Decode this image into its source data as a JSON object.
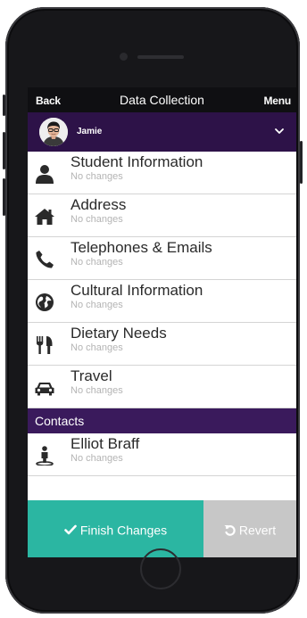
{
  "nav": {
    "back": "Back",
    "title": "Data Collection",
    "menu": "Menu"
  },
  "user": {
    "name": "Jamie"
  },
  "menu": {
    "items": [
      {
        "title": "Student Information",
        "status": "No changes",
        "icon": "user-icon"
      },
      {
        "title": "Address",
        "status": "No changes",
        "icon": "home-icon"
      },
      {
        "title": "Telephones & Emails",
        "status": "No changes",
        "icon": "phone-icon"
      },
      {
        "title": "Cultural Information",
        "status": "No changes",
        "icon": "globe-icon"
      },
      {
        "title": "Dietary Needs",
        "status": "No changes",
        "icon": "cutlery-icon"
      },
      {
        "title": "Travel",
        "status": "No changes",
        "icon": "car-icon"
      }
    ],
    "contacts_label": "Contacts",
    "contacts": [
      {
        "title": "Elliot Braff",
        "status": "No changes",
        "icon": "contact-person-icon"
      }
    ]
  },
  "actions": {
    "finish": "Finish Changes",
    "revert": "Revert"
  },
  "colors": {
    "primary": "#2d1248",
    "section": "#3a1a5c",
    "finish": "#2bb6a2",
    "revert": "#c7c7c7"
  }
}
